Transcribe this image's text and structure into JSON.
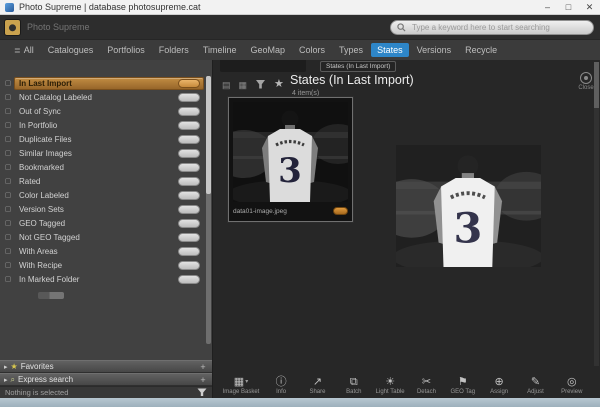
{
  "window": {
    "title": "Photo Supreme | database photosupreme.cat",
    "minimize": "–",
    "maximize": "□",
    "close": "✕"
  },
  "header": {
    "app_name": "Photo Supreme",
    "search_placeholder": "Type a keyword here to start searching"
  },
  "nav": {
    "tabs": [
      {
        "label": "All",
        "icon": "grid-icon",
        "active": false
      },
      {
        "label": "Catalogues",
        "active": false
      },
      {
        "label": "Portfolios",
        "active": false
      },
      {
        "label": "Folders",
        "active": false
      },
      {
        "label": "Timeline",
        "active": false
      },
      {
        "label": "GeoMap",
        "active": false
      },
      {
        "label": "Colors",
        "active": false
      },
      {
        "label": "Types",
        "active": false
      },
      {
        "label": "States",
        "active": true
      },
      {
        "label": "Versions",
        "active": false
      },
      {
        "label": "Recycle",
        "active": false
      }
    ]
  },
  "sidebar": {
    "items": [
      {
        "label": "In Last Import",
        "selected": true
      },
      {
        "label": "Not Catalog Labeled",
        "selected": false
      },
      {
        "label": "Out of Sync",
        "selected": false
      },
      {
        "label": "In Portfolio",
        "selected": false
      },
      {
        "label": "Duplicate Files",
        "selected": false
      },
      {
        "label": "Similar Images",
        "selected": false
      },
      {
        "label": "Bookmarked",
        "selected": false
      },
      {
        "label": "Rated",
        "selected": false
      },
      {
        "label": "Color Labeled",
        "selected": false
      },
      {
        "label": "Version Sets",
        "selected": false
      },
      {
        "label": "GEO Tagged",
        "selected": false
      },
      {
        "label": "Not GEO Tagged",
        "selected": false
      },
      {
        "label": "With Areas",
        "selected": false
      },
      {
        "label": "With Recipe",
        "selected": false
      },
      {
        "label": "In Marked Folder",
        "selected": false
      }
    ],
    "panels": [
      {
        "label": "Favorites",
        "icon": "star-icon"
      },
      {
        "label": "Express search",
        "icon": "search-icon"
      }
    ],
    "status": "Nothing is selected"
  },
  "main": {
    "tab_tooltip": "States (In Last Import)",
    "title": "States (In Last Import)",
    "count": "4 item(s)",
    "close_label": "Close",
    "card": {
      "filename": "data01-image.jpeg"
    },
    "toolbar": [
      {
        "label": "Image Basket",
        "icon": "image-basket-icon",
        "dropdown": true
      },
      {
        "label": "Info",
        "icon": "info-icon"
      },
      {
        "label": "Share",
        "icon": "share-icon"
      },
      {
        "label": "Batch",
        "icon": "batch-icon"
      },
      {
        "label": "Light Table",
        "icon": "light-table-icon"
      },
      {
        "label": "Detach",
        "icon": "detach-icon"
      },
      {
        "label": "GEO Tag",
        "icon": "geo-tag-icon"
      },
      {
        "label": "Assign",
        "icon": "assign-icon"
      },
      {
        "label": "Adjust",
        "icon": "adjust-icon"
      },
      {
        "label": "Preview",
        "icon": "preview-icon"
      }
    ]
  },
  "colors": {
    "accent_blue": "#2e86c8",
    "selection_orange": "#c28c42",
    "statusbar_blue": "#a9bdc7"
  }
}
